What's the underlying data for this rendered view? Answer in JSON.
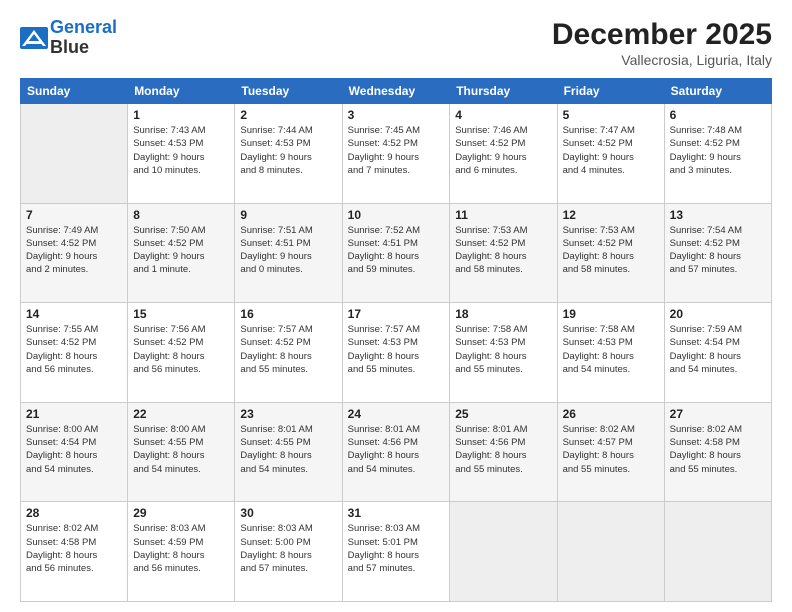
{
  "header": {
    "logo_line1": "General",
    "logo_line2": "Blue",
    "month_title": "December 2025",
    "location": "Vallecrosia, Liguria, Italy"
  },
  "weekdays": [
    "Sunday",
    "Monday",
    "Tuesday",
    "Wednesday",
    "Thursday",
    "Friday",
    "Saturday"
  ],
  "weeks": [
    [
      {
        "day": "",
        "info": ""
      },
      {
        "day": "1",
        "info": "Sunrise: 7:43 AM\nSunset: 4:53 PM\nDaylight: 9 hours\nand 10 minutes."
      },
      {
        "day": "2",
        "info": "Sunrise: 7:44 AM\nSunset: 4:53 PM\nDaylight: 9 hours\nand 8 minutes."
      },
      {
        "day": "3",
        "info": "Sunrise: 7:45 AM\nSunset: 4:52 PM\nDaylight: 9 hours\nand 7 minutes."
      },
      {
        "day": "4",
        "info": "Sunrise: 7:46 AM\nSunset: 4:52 PM\nDaylight: 9 hours\nand 6 minutes."
      },
      {
        "day": "5",
        "info": "Sunrise: 7:47 AM\nSunset: 4:52 PM\nDaylight: 9 hours\nand 4 minutes."
      },
      {
        "day": "6",
        "info": "Sunrise: 7:48 AM\nSunset: 4:52 PM\nDaylight: 9 hours\nand 3 minutes."
      }
    ],
    [
      {
        "day": "7",
        "info": "Sunrise: 7:49 AM\nSunset: 4:52 PM\nDaylight: 9 hours\nand 2 minutes."
      },
      {
        "day": "8",
        "info": "Sunrise: 7:50 AM\nSunset: 4:52 PM\nDaylight: 9 hours\nand 1 minute."
      },
      {
        "day": "9",
        "info": "Sunrise: 7:51 AM\nSunset: 4:51 PM\nDaylight: 9 hours\nand 0 minutes."
      },
      {
        "day": "10",
        "info": "Sunrise: 7:52 AM\nSunset: 4:51 PM\nDaylight: 8 hours\nand 59 minutes."
      },
      {
        "day": "11",
        "info": "Sunrise: 7:53 AM\nSunset: 4:52 PM\nDaylight: 8 hours\nand 58 minutes."
      },
      {
        "day": "12",
        "info": "Sunrise: 7:53 AM\nSunset: 4:52 PM\nDaylight: 8 hours\nand 58 minutes."
      },
      {
        "day": "13",
        "info": "Sunrise: 7:54 AM\nSunset: 4:52 PM\nDaylight: 8 hours\nand 57 minutes."
      }
    ],
    [
      {
        "day": "14",
        "info": "Sunrise: 7:55 AM\nSunset: 4:52 PM\nDaylight: 8 hours\nand 56 minutes."
      },
      {
        "day": "15",
        "info": "Sunrise: 7:56 AM\nSunset: 4:52 PM\nDaylight: 8 hours\nand 56 minutes."
      },
      {
        "day": "16",
        "info": "Sunrise: 7:57 AM\nSunset: 4:52 PM\nDaylight: 8 hours\nand 55 minutes."
      },
      {
        "day": "17",
        "info": "Sunrise: 7:57 AM\nSunset: 4:53 PM\nDaylight: 8 hours\nand 55 minutes."
      },
      {
        "day": "18",
        "info": "Sunrise: 7:58 AM\nSunset: 4:53 PM\nDaylight: 8 hours\nand 55 minutes."
      },
      {
        "day": "19",
        "info": "Sunrise: 7:58 AM\nSunset: 4:53 PM\nDaylight: 8 hours\nand 54 minutes."
      },
      {
        "day": "20",
        "info": "Sunrise: 7:59 AM\nSunset: 4:54 PM\nDaylight: 8 hours\nand 54 minutes."
      }
    ],
    [
      {
        "day": "21",
        "info": "Sunrise: 8:00 AM\nSunset: 4:54 PM\nDaylight: 8 hours\nand 54 minutes."
      },
      {
        "day": "22",
        "info": "Sunrise: 8:00 AM\nSunset: 4:55 PM\nDaylight: 8 hours\nand 54 minutes."
      },
      {
        "day": "23",
        "info": "Sunrise: 8:01 AM\nSunset: 4:55 PM\nDaylight: 8 hours\nand 54 minutes."
      },
      {
        "day": "24",
        "info": "Sunrise: 8:01 AM\nSunset: 4:56 PM\nDaylight: 8 hours\nand 54 minutes."
      },
      {
        "day": "25",
        "info": "Sunrise: 8:01 AM\nSunset: 4:56 PM\nDaylight: 8 hours\nand 55 minutes."
      },
      {
        "day": "26",
        "info": "Sunrise: 8:02 AM\nSunset: 4:57 PM\nDaylight: 8 hours\nand 55 minutes."
      },
      {
        "day": "27",
        "info": "Sunrise: 8:02 AM\nSunset: 4:58 PM\nDaylight: 8 hours\nand 55 minutes."
      }
    ],
    [
      {
        "day": "28",
        "info": "Sunrise: 8:02 AM\nSunset: 4:58 PM\nDaylight: 8 hours\nand 56 minutes."
      },
      {
        "day": "29",
        "info": "Sunrise: 8:03 AM\nSunset: 4:59 PM\nDaylight: 8 hours\nand 56 minutes."
      },
      {
        "day": "30",
        "info": "Sunrise: 8:03 AM\nSunset: 5:00 PM\nDaylight: 8 hours\nand 57 minutes."
      },
      {
        "day": "31",
        "info": "Sunrise: 8:03 AM\nSunset: 5:01 PM\nDaylight: 8 hours\nand 57 minutes."
      },
      {
        "day": "",
        "info": ""
      },
      {
        "day": "",
        "info": ""
      },
      {
        "day": "",
        "info": ""
      }
    ]
  ]
}
